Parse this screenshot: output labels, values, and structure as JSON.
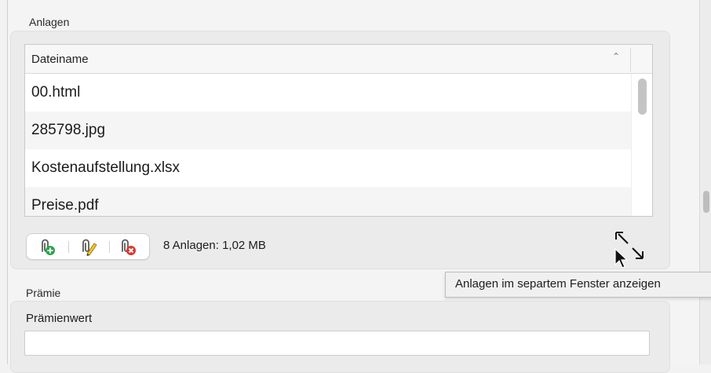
{
  "attachments_section": {
    "label": "Anlagen",
    "table": {
      "column_header": "Dateiname",
      "sort_icon": "chevron-up-icon",
      "rows": [
        "00.html",
        "285798.jpg",
        "Kostenaufstellung.xlsx",
        "Preise.pdf"
      ]
    },
    "toolbar": {
      "add_icon": "paperclip-add-icon",
      "edit_icon": "paperclip-edit-icon",
      "remove_icon": "paperclip-remove-icon"
    },
    "summary": "8 Anlagen: 1,02 MB",
    "expand_icon": "expand-arrows-icon",
    "tooltip": "Anlagen im separtem Fenster anzeigen"
  },
  "premium_section": {
    "label": "Prämie",
    "field_label": "Prämienwert",
    "field_value": ""
  },
  "colors": {
    "add_green": "#2aa54a",
    "remove_red": "#e0352b",
    "edit_yellow": "#f3c623",
    "paperclip_gray": "#5a5a5a"
  }
}
